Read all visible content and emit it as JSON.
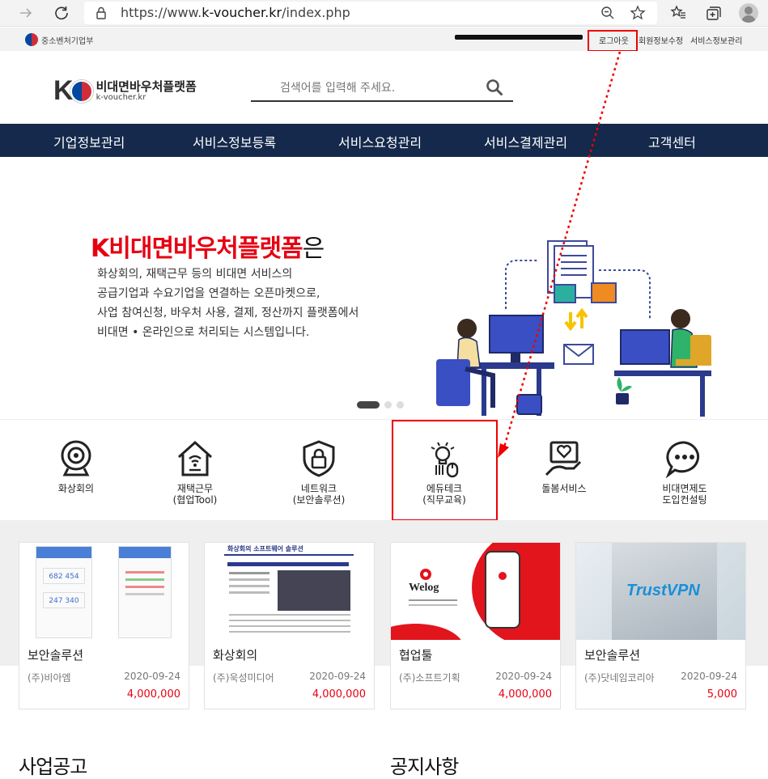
{
  "browser": {
    "url_prefix": "https://www.",
    "url_host": "k-voucher.kr",
    "url_path": "/index.php",
    "back_icon": "arrow-right-icon",
    "reload_icon": "reload-icon",
    "lock_icon": "lock-icon",
    "zoom_icon": "zoom-out-icon",
    "star_icon": "star-icon",
    "favorites_icon": "favorites-icon",
    "collections_icon": "collections-icon",
    "profile_icon": "avatar-icon"
  },
  "util": {
    "ministry": "중소벤처기업부",
    "logout": "로그아웃",
    "member_edit": "회원정보수정",
    "service_info": "서비스정보관리"
  },
  "header": {
    "logo_title": "비대면바우처플랫폼",
    "logo_domain": "k-voucher.kr",
    "search_placeholder": "검색어를 입력해 주세요."
  },
  "nav": [
    "기업정보관리",
    "서비스정보등록",
    "서비스요청관리",
    "서비스결제관리",
    "고객센터"
  ],
  "hero": {
    "title_red": "K비대면바우처플랫폼",
    "title_rest": "은",
    "lines": [
      "화상회의, 재택근무 등의 비대면 서비스의",
      "공급기업과 수요기업을 연결하는 오픈마켓으로,",
      "사업 참여신청, 바우처 사용, 결제, 정산까지 플랫폼에서",
      "비대면 • 온라인으로 처리되는 시스템입니다."
    ]
  },
  "categories": [
    {
      "line1": "화상회의",
      "line2": ""
    },
    {
      "line1": "재택근무",
      "line2": "(협업Tool)"
    },
    {
      "line1": "네트워크",
      "line2": "(보안솔루션)"
    },
    {
      "line1": "에듀테크",
      "line2": "(직무교육)"
    },
    {
      "line1": "돌봄서비스",
      "line2": ""
    },
    {
      "line1": "비대면제도",
      "line2": "도입컨설팅"
    }
  ],
  "cards": [
    {
      "name": "보안솔루션",
      "company": "(주)비아엠",
      "date": "2020-09-24",
      "price": "4,000,000"
    },
    {
      "name": "화상회의",
      "company": "(주)욱성미디어",
      "date": "2020-09-24",
      "price": "4,000,000"
    },
    {
      "name": "협업툴",
      "company": "(주)소프트기획",
      "date": "2020-09-24",
      "price": "4,000,000"
    },
    {
      "name": "보안솔루션",
      "company": "(주)닷네임코리아",
      "date": "2020-09-24",
      "price": "5,000"
    }
  ],
  "card_thumb_text": {
    "phone_value_1": "682 454",
    "phone_value_2": "247 340",
    "video_title": "화상회의 소프트웨어 솔루션",
    "welog": "Welog",
    "trustvpn": "TrustVPN"
  },
  "sections": {
    "business": "사업공고",
    "notice": "공지사항"
  },
  "colors": {
    "nav_bg": "#14294b",
    "accent_red": "#e60012",
    "annotation_red": "#e00000"
  }
}
